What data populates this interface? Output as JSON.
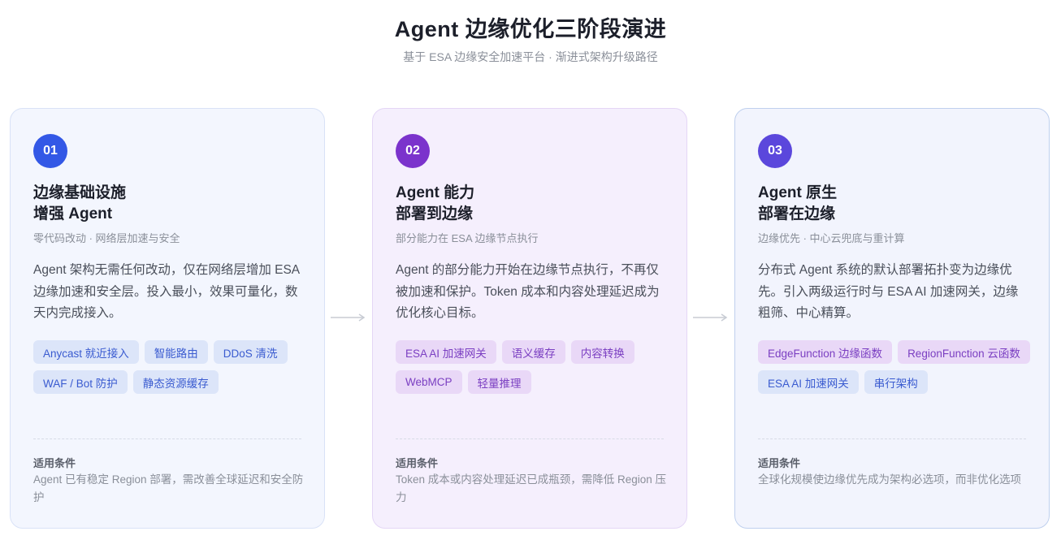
{
  "header": {
    "title": "Agent 边缘优化三阶段演进",
    "subtitle": "基于 ESA 边缘安全加速平台 · 渐进式架构升级路径"
  },
  "cards": [
    {
      "number": "01",
      "title_line1": "边缘基础设施",
      "title_line2": "增强 Agent",
      "subtitle": "零代码改动 · 网络层加速与安全",
      "description": "Agent 架构无需任何改动，仅在网络层增加 ESA 边缘加速和安全层。投入最小，效果可量化，数天内完成接入。",
      "tags": [
        "Anycast 就近接入",
        "智能路由",
        "DDoS 清洗",
        "WAF / Bot 防护",
        "静态资源缓存"
      ],
      "condition_label": "适用条件",
      "condition_text": "Agent 已有稳定 Region 部署，需改善全球延迟和安全防护"
    },
    {
      "number": "02",
      "title_line1": "Agent 能力",
      "title_line2": "部署到边缘",
      "subtitle": "部分能力在 ESA 边缘节点执行",
      "description": "Agent 的部分能力开始在边缘节点执行，不再仅被加速和保护。Token 成本和内容处理延迟成为优化核心目标。",
      "tags": [
        "ESA AI 加速网关",
        "语义缓存",
        "内容转换",
        "WebMCP",
        "轻量推理"
      ],
      "condition_label": "适用条件",
      "condition_text": "Token 成本或内容处理延迟已成瓶颈，需降低 Region 压力"
    },
    {
      "number": "03",
      "title_line1": "Agent 原生",
      "title_line2": "部署在边缘",
      "subtitle": "边缘优先 · 中心云兜底与重计算",
      "description": "分布式 Agent 系统的默认部署拓扑变为边缘优先。引入两级运行时与 ESA AI 加速网关，边缘粗筛、中心精算。",
      "tags": [
        "EdgeFunction 边缘函数",
        "RegionFunction 云函数",
        "ESA AI 加速网关",
        "串行架构"
      ],
      "condition_label": "适用条件",
      "condition_text": "全球化规模使边缘优先成为架构必选项，而非优化选项"
    }
  ],
  "colors": {
    "badge_1": "#3358e6",
    "badge_2": "#7b33cc",
    "badge_3": "#5b47dc",
    "arrow": "#c8ccd4"
  },
  "icons": [
    "arrow-right-icon"
  ]
}
